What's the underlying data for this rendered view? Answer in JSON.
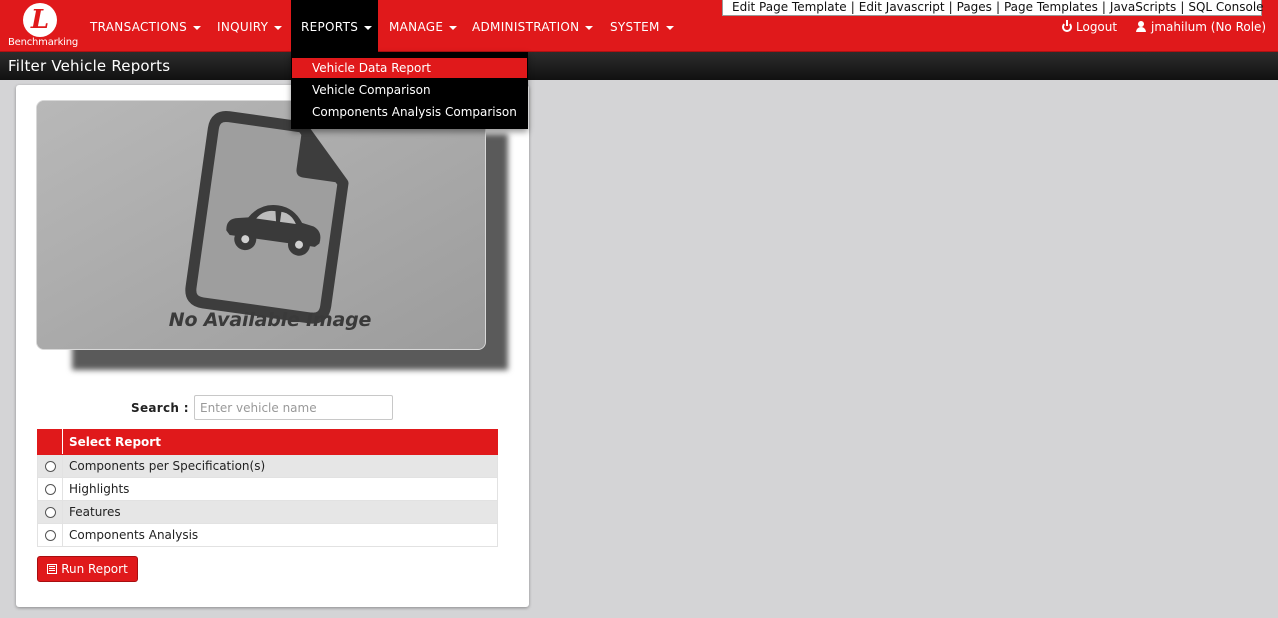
{
  "brand": {
    "logo_letter": "L",
    "name": "Benchmarking"
  },
  "nav": {
    "items": [
      {
        "label": "TRANSACTIONS"
      },
      {
        "label": "INQUIRY"
      },
      {
        "label": "REPORTS"
      },
      {
        "label": "MANAGE"
      },
      {
        "label": "ADMINISTRATION"
      },
      {
        "label": "SYSTEM"
      }
    ],
    "active": "REPORTS",
    "logout": "Logout",
    "user": "jmahilum (No Role)"
  },
  "devbar": {
    "links": [
      "Edit Page Template",
      "Edit Javascript",
      "Pages",
      "Page Templates",
      "JavaScripts",
      "SQL Console"
    ]
  },
  "page": {
    "title": "Filter Vehicle Reports"
  },
  "reports_menu": {
    "items": [
      "Vehicle Data Report",
      "Vehicle Comparison",
      "Components Analysis Comparison"
    ],
    "highlighted": "Vehicle Data Report"
  },
  "image": {
    "caption": "No Available Image"
  },
  "search": {
    "label": "Search :",
    "placeholder": "Enter vehicle name",
    "value": ""
  },
  "report_table": {
    "header": "Select Report",
    "rows": [
      "Components per Specification(s)",
      "Highlights",
      "Features",
      "Components Analysis"
    ]
  },
  "run_button": {
    "label": "Run Report"
  },
  "colors": {
    "brand_red": "#e0191b",
    "dark_bar": "#111111",
    "background": "#d4d4d6"
  }
}
